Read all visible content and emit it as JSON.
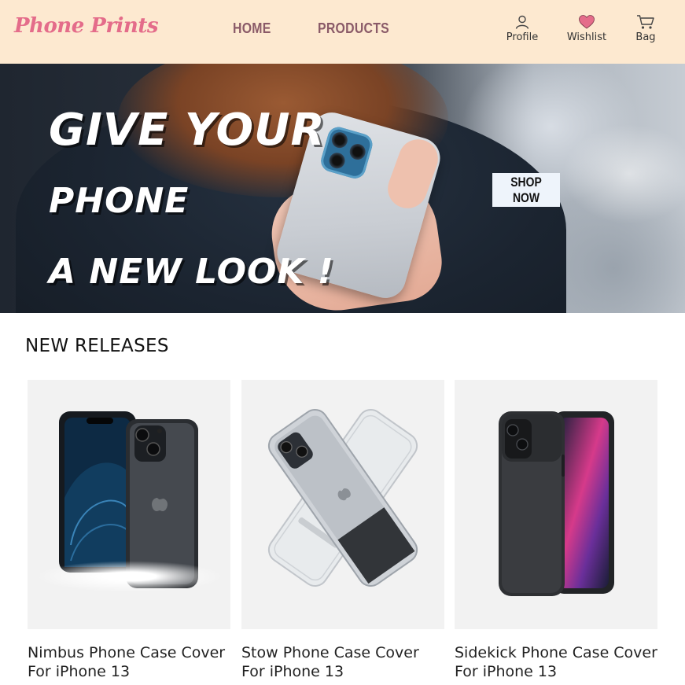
{
  "brand": {
    "logo_text": "Phone Prints"
  },
  "nav": [
    {
      "label": "HOME"
    },
    {
      "label": "PRODUCTS"
    }
  ],
  "header_actions": [
    {
      "label": "Profile",
      "icon": "user-icon"
    },
    {
      "label": "Wishlist",
      "icon": "heart-icon"
    },
    {
      "label": "Bag",
      "icon": "cart-icon"
    }
  ],
  "hero": {
    "headline_lines": [
      "Give your",
      "phone",
      "a new look !"
    ],
    "cta_label": "SHOP NOW"
  },
  "new_releases": {
    "title": "NEW RELEASES",
    "products": [
      {
        "name": "Nimbus Phone Case Cover For iPhone 13"
      },
      {
        "name": "Stow Phone Case Cover For iPhone 13"
      },
      {
        "name": "Sidekick Phone Case Cover For iPhone 13"
      }
    ]
  },
  "colors": {
    "header_bg": "#fde9d0",
    "logo": "#e46c8a",
    "nav_text": "#8a5a68",
    "heart": "#e46c8a",
    "card_bg": "#f2f2f2"
  }
}
